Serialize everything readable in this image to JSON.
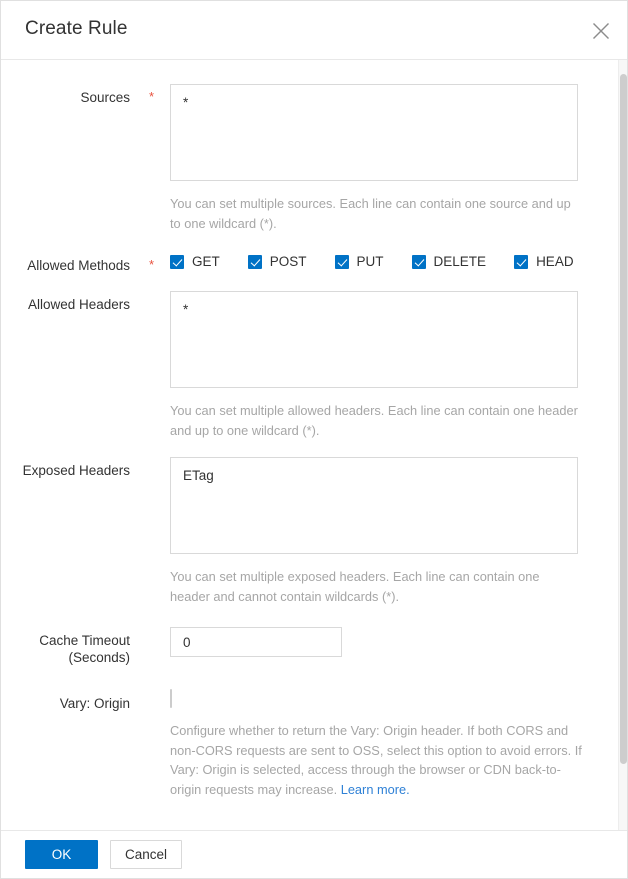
{
  "dialog": {
    "title": "Create Rule",
    "close_icon": "close-icon"
  },
  "form": {
    "sources": {
      "label": "Sources",
      "required_marker": "*",
      "value": "*",
      "hint": "You can set multiple sources. Each line can contain one source and up to one wildcard (*)."
    },
    "allowed_methods": {
      "label": "Allowed Methods",
      "required_marker": "*",
      "options": [
        {
          "label": "GET",
          "checked": true
        },
        {
          "label": "POST",
          "checked": true
        },
        {
          "label": "PUT",
          "checked": true
        },
        {
          "label": "DELETE",
          "checked": true
        },
        {
          "label": "HEAD",
          "checked": true
        }
      ]
    },
    "allowed_headers": {
      "label": "Allowed Headers",
      "value": "*",
      "hint": "You can set multiple allowed headers. Each line can contain one header and up to one wildcard (*)."
    },
    "exposed_headers": {
      "label": "Exposed Headers",
      "value": "ETag",
      "hint": "You can set multiple exposed headers. Each line can contain one header and cannot contain wildcards (*)."
    },
    "cache_timeout": {
      "label_line1": "Cache Timeout",
      "label_line2": "(Seconds)",
      "value": "0"
    },
    "vary_origin": {
      "label": "Vary: Origin",
      "checked": false,
      "hint_text": "Configure whether to return the Vary: Origin header. If both CORS and non-CORS requests are sent to OSS, select this option to avoid errors. If Vary: Origin is selected, access through the browser or CDN back-to-origin requests may increase. ",
      "hint_link": "Learn more.",
      "link_color": "#2f81d6"
    }
  },
  "footer": {
    "ok_label": "OK",
    "cancel_label": "Cancel",
    "primary_color": "#0072c6"
  }
}
